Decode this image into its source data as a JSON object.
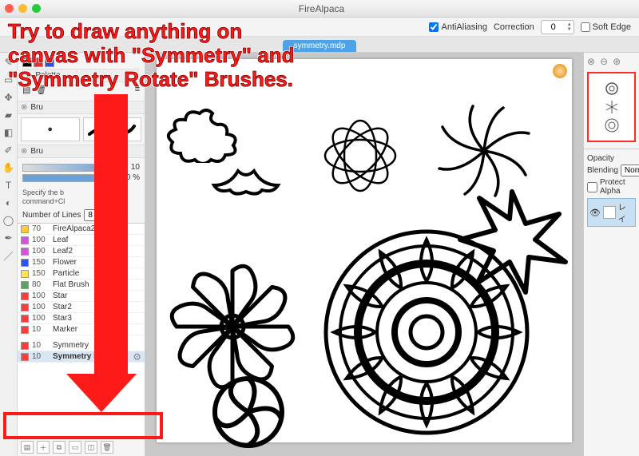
{
  "window": {
    "title": "FireAlpaca"
  },
  "toolbar": {
    "antialias_label": "AntiAliasing",
    "antialias_checked": true,
    "correction_label": "Correction",
    "correction_value": "0",
    "softedge_label": "Soft Edge",
    "softedge_checked": false
  },
  "tab": {
    "filename": "symmetry.mdp"
  },
  "palette": {
    "label": "Palette"
  },
  "brush_section": {
    "size_label": "",
    "size_value": "10",
    "opacity_value": "100 %",
    "hint_line1": "Specify the b",
    "hint_line2": "command+Cl",
    "numlines_label": "Number of Lines",
    "numlines_value": "8"
  },
  "brushes": [
    {
      "size": "70",
      "name": "FireAlpaca2",
      "color": "#ffcc33"
    },
    {
      "size": "100",
      "name": "Leaf",
      "color": "#d94fe0"
    },
    {
      "size": "100",
      "name": "Leaf2",
      "color": "#d94fe0"
    },
    {
      "size": "150",
      "name": "Flower",
      "color": "#2953ff"
    },
    {
      "size": "150",
      "name": "Particle",
      "color": "#ffe44d"
    },
    {
      "size": "80",
      "name": "Flat Brush",
      "color": "#5aa35a"
    },
    {
      "size": "100",
      "name": "Star",
      "color": "#ff3b3b"
    },
    {
      "size": "100",
      "name": "Star2",
      "color": "#ff3b3b"
    },
    {
      "size": "100",
      "name": "Star3",
      "color": "#ff3b3b"
    },
    {
      "size": "10",
      "name": "Marker",
      "color": "#ff3b3b"
    },
    {
      "size": "10",
      "name": "Symmetry",
      "color": "#ff3b3b",
      "group": "sym"
    },
    {
      "size": "10",
      "name": "Symmetry Rotate",
      "color": "#ff3b3b",
      "group": "sym",
      "selected": true,
      "gear": true
    }
  ],
  "right": {
    "opacity_label": "Opacity",
    "blending_label": "Blending",
    "blending_value": "Norm",
    "protect_label": "Protect Alpha",
    "layer_name": "レイ"
  },
  "callout": {
    "line1": "Try to draw anything on",
    "line2": "canvas with \"Symmetry\" and",
    "line3": "\"Symmetry Rotate\" Brushes."
  }
}
